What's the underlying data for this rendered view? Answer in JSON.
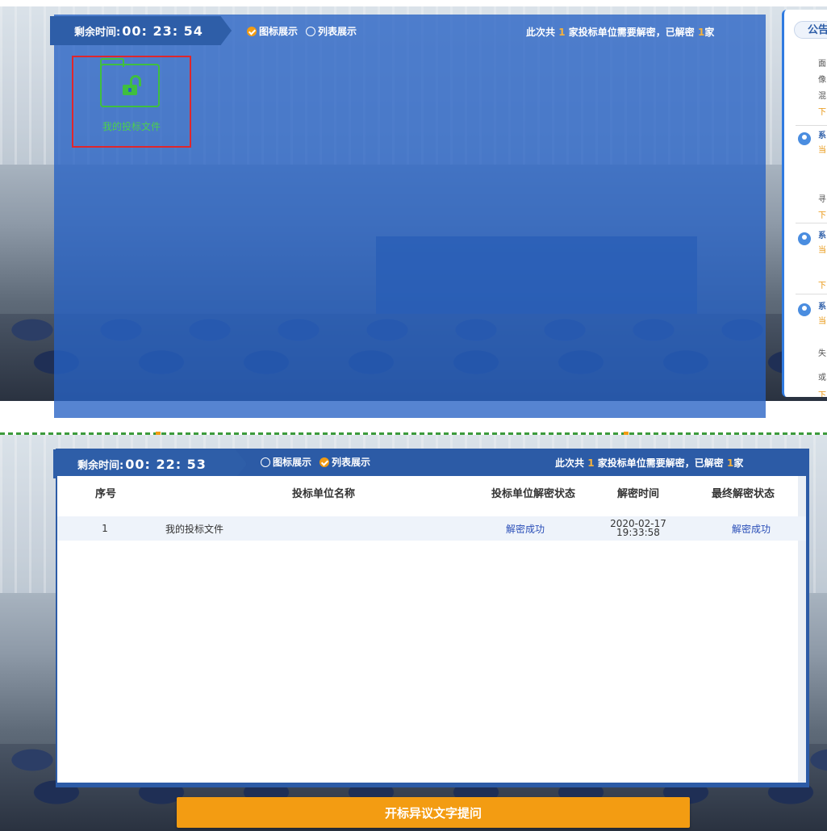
{
  "top_view": {
    "timer": {
      "label": "剩余时间:",
      "value": "00: 23: 54"
    },
    "view_toggle": {
      "icon_label": "图标展示",
      "list_label": "列表展示",
      "selected": "icon"
    },
    "summary": {
      "prefix": "此次共",
      "total": "1",
      "middle": "家投标单位需要解密，已解密",
      "decrypted": "1",
      "suffix": "家"
    },
    "file": {
      "label": "我的投标文件"
    },
    "notice": {
      "tab_label": "公告",
      "lines_a": [
        "面",
        "像",
        "混"
      ],
      "orange_a": "下",
      "blue_1": "系",
      "orange_b": "当",
      "line_b": "寻",
      "orange_c": "下",
      "blue_2": "系",
      "orange_d": "当",
      "orange_e": "下",
      "blue_3": "系",
      "orange_f": "当",
      "line_c": "失",
      "line_d": "或",
      "orange_g": "下"
    }
  },
  "bottom_view": {
    "timer": {
      "label": "剩余时间:",
      "value": "00: 22: 53"
    },
    "view_toggle": {
      "icon_label": "图标展示",
      "list_label": "列表展示",
      "selected": "list"
    },
    "summary": {
      "prefix": "此次共",
      "total": "1",
      "middle": "家投标单位需要解密，已解密",
      "decrypted": "1",
      "suffix": "家"
    },
    "table": {
      "headers": [
        "序号",
        "投标单位名称",
        "投标单位解密状态",
        "解密时间",
        "最终解密状态"
      ],
      "rows": [
        {
          "index": "1",
          "name": "我的投标文件",
          "status": "解密成功",
          "date": "2020-02-17",
          "time": "19:33:58",
          "final": "解密成功"
        }
      ]
    },
    "action_button": "开标异议文字提问"
  },
  "colors": {
    "accent_orange": "#f39c12",
    "panel_blue": "#2c5ba6",
    "success_green": "#3fbf3f",
    "highlight_red": "#e0262b"
  }
}
